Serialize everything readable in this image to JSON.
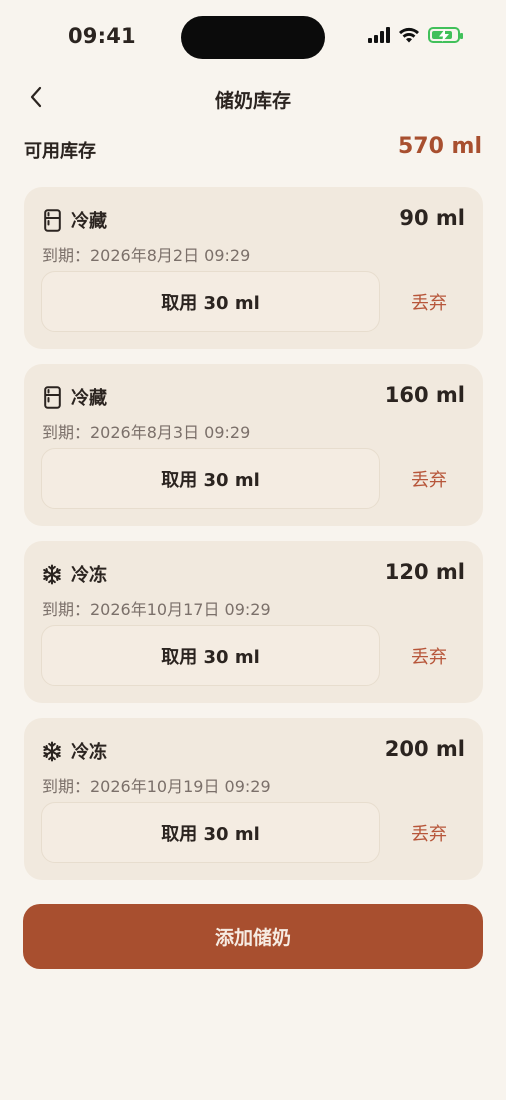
{
  "status_bar": {
    "time": "09:41"
  },
  "header": {
    "title": "储奶库存",
    "back_icon": "chevron-left-icon"
  },
  "summary": {
    "label": "可用库存",
    "value": "570 ml"
  },
  "cards": [
    {
      "type": "冷藏",
      "icon": "fridge-icon",
      "amount": "90 ml",
      "expiry": "到期：2026年8月2日 09:29",
      "take_label": "取用 30 ml",
      "discard_label": "丢弃"
    },
    {
      "type": "冷藏",
      "icon": "fridge-icon",
      "amount": "160 ml",
      "expiry": "到期：2026年8月3日 09:29",
      "take_label": "取用 30 ml",
      "discard_label": "丢弃"
    },
    {
      "type": "冷冻",
      "icon": "snowflake-icon",
      "amount": "120 ml",
      "expiry": "到期：2026年10月17日 09:29",
      "take_label": "取用 30 ml",
      "discard_label": "丢弃"
    },
    {
      "type": "冷冻",
      "icon": "snowflake-icon",
      "amount": "200 ml",
      "expiry": "到期：2026年10月19日 09:29",
      "take_label": "取用 30 ml",
      "discard_label": "丢弃"
    }
  ],
  "add_button": {
    "label": "添加储奶"
  },
  "colors": {
    "accent": "#a84f2f",
    "background": "#f8f4ee",
    "card": "#f1e9de",
    "discard_text": "#b7563a",
    "battery": "#41c05a"
  }
}
